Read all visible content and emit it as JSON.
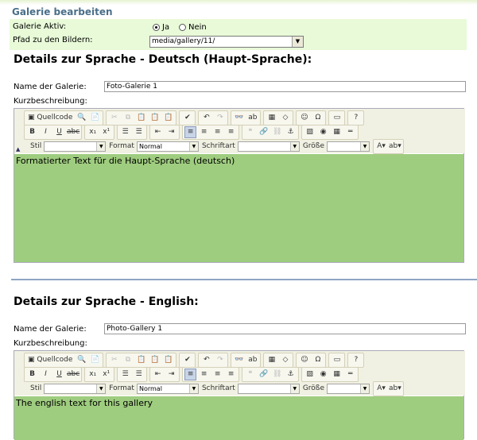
{
  "page": {
    "title": "Galerie bearbeiten"
  },
  "settings": {
    "active_label": "Galerie Aktiv:",
    "radio_yes": "Ja",
    "radio_no": "Nein",
    "path_label": "Pfad zu den Bildern:",
    "path_value": "media/gallery/11/"
  },
  "toolbar": {
    "source_label": "Quellcode",
    "style_label": "Stil",
    "format_label": "Format",
    "format_value": "Normal",
    "font_label": "Schriftart",
    "size_label": "Größe"
  },
  "sections": [
    {
      "title": "Details zur Sprache - Deutsch (Haupt-Sprache):",
      "name_label": "Name der Galerie:",
      "name_value": "Foto-Galerie 1",
      "desc_label": "Kurzbeschreibung:",
      "content": "Formatierter Text für die Haupt-Sprache (deutsch)"
    },
    {
      "title": "Details zur Sprache - English:",
      "name_label": "Name der Galerie:",
      "name_value": "Photo-Gallery 1",
      "desc_label": "Kurzbeschreibung:",
      "content": "The english text for this gallery"
    }
  ],
  "colors": {
    "content_bg": "#9fcd7f",
    "settings_bg": "#e8fad8",
    "title": "#4a6f8a"
  }
}
